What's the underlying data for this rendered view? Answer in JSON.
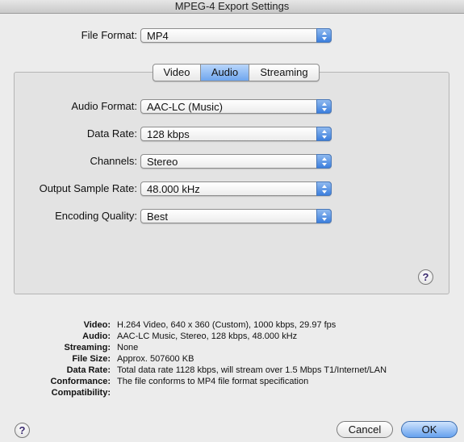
{
  "window": {
    "title": "MPEG-4 Export Settings"
  },
  "file_format": {
    "label": "File Format:",
    "value": "MP4"
  },
  "tabs": [
    {
      "label": "Video",
      "active": false
    },
    {
      "label": "Audio",
      "active": true
    },
    {
      "label": "Streaming",
      "active": false
    }
  ],
  "audio": {
    "audio_format": {
      "label": "Audio Format:",
      "value": "AAC-LC (Music)"
    },
    "data_rate": {
      "label": "Data Rate:",
      "value": "128 kbps"
    },
    "channels": {
      "label": "Channels:",
      "value": "Stereo"
    },
    "sample_rate": {
      "label": "Output Sample Rate:",
      "value": "48.000 kHz"
    },
    "encoding_quality": {
      "label": "Encoding Quality:",
      "value": "Best"
    }
  },
  "help": {
    "symbol": "?"
  },
  "summary": {
    "video": {
      "key": "Video:",
      "value": "H.264 Video, 640 x 360 (Custom), 1000 kbps, 29.97 fps"
    },
    "audio": {
      "key": "Audio:",
      "value": "AAC-LC Music, Stereo, 128 kbps, 48.000 kHz"
    },
    "streaming": {
      "key": "Streaming:",
      "value": "None"
    },
    "file_size": {
      "key": "File Size:",
      "value": "Approx. 507600 KB"
    },
    "data_rate": {
      "key": "Data Rate:",
      "value": "Total data rate 1128 kbps, will stream over 1.5 Mbps T1/Internet/LAN"
    },
    "conformance": {
      "key": "Conformance:",
      "value": "The file conforms to MP4 file format specification"
    },
    "compatibility": {
      "key": "Compatibility:",
      "value": ""
    }
  },
  "buttons": {
    "cancel": "Cancel",
    "ok": "OK"
  },
  "colors": {
    "accent": "#3c7fdd",
    "background": "#ececec",
    "panel": "#e3e3e3"
  }
}
